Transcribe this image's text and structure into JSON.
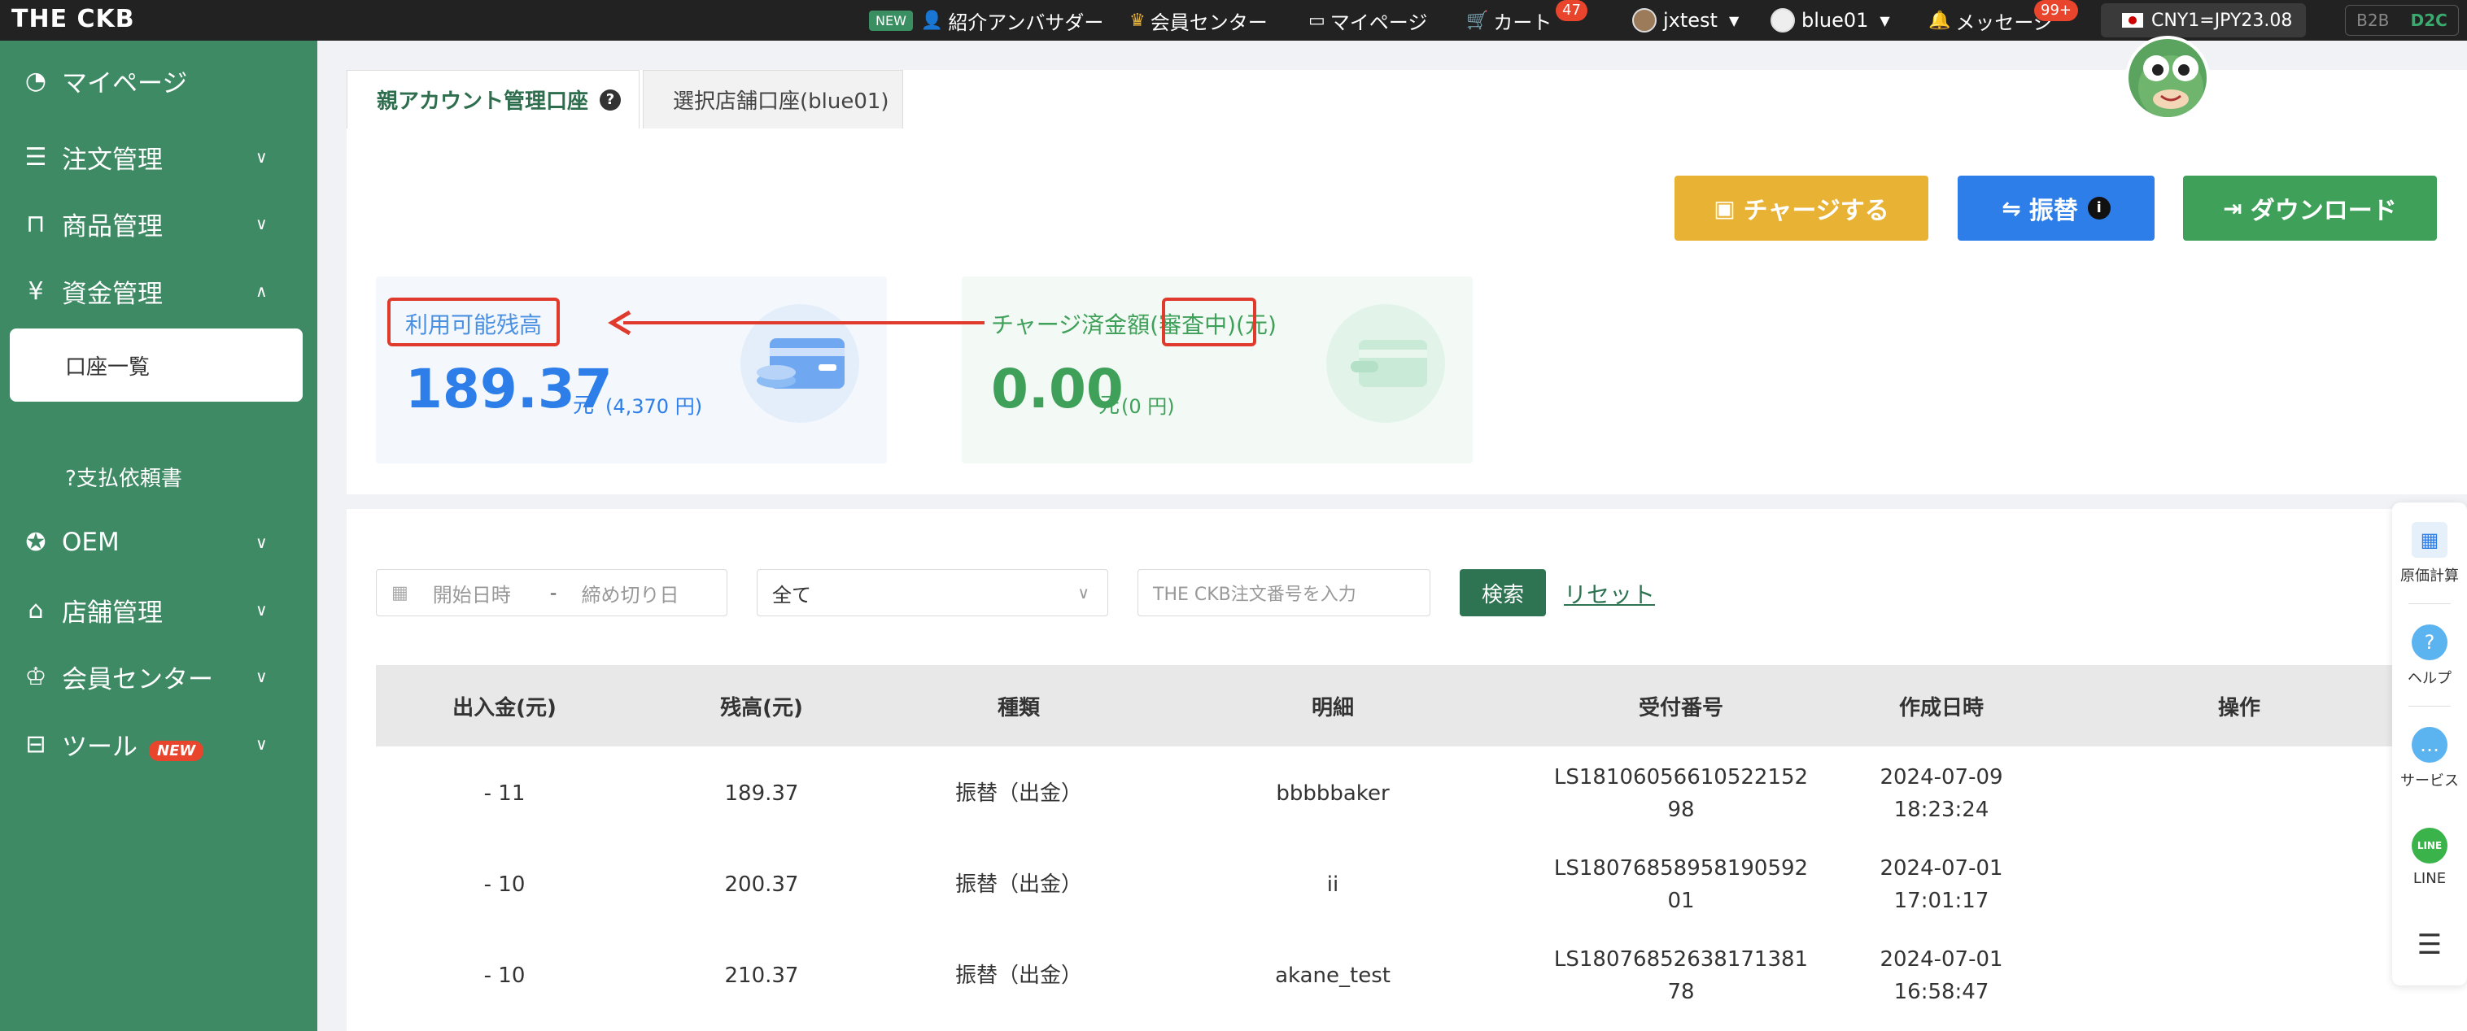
{
  "topbar": {
    "logo": "THE CKB",
    "new_tag": "NEW",
    "ambassador": "紹介アンバサダー",
    "member_center": "会員センター",
    "mypage": "マイページ",
    "cart": "カート",
    "cart_count": "47",
    "user1": "jxtest",
    "user2": "blue01",
    "messages": "メッセージ",
    "messages_count": "99+",
    "rate": "CNY1=JPY23.08",
    "b2b": "B2B",
    "d2c": "D2C"
  },
  "sidebar": {
    "mypage": "マイページ",
    "orders": "注文管理",
    "products": "商品管理",
    "funds": "資金管理",
    "account_list": "口座一覧",
    "payment_request": "支払依頼書",
    "oem": "OEM",
    "stores": "店舗管理",
    "member": "会員センター",
    "tools": "ツール",
    "tools_new": "NEW"
  },
  "tabs": {
    "parent": "親アカウント管理口座",
    "store": "選択店舗口座(blue01)"
  },
  "actions": {
    "charge": "チャージする",
    "transfer": "振替",
    "download": "ダウンロード"
  },
  "balance": {
    "available_label": "利用可能残高",
    "available_amount": "189.37",
    "available_unit": "元",
    "available_jpy": "(4,370 円)",
    "charged_label_a": "チャージ済金額",
    "charged_label_b": "(審査中",
    "charged_label_c": ")(元)",
    "charged_amount": "0.00",
    "charged_unit": "元",
    "charged_jpy": "(0 円)"
  },
  "filters": {
    "start_placeholder": "開始日時",
    "dash": "-",
    "end_placeholder": "締め切り日",
    "type_value": "全て",
    "order_placeholder": "THE CKB注文番号を入力",
    "search": "検索",
    "reset": "リセット"
  },
  "table": {
    "headers": [
      "出入金(元)",
      "残高(元)",
      "種類",
      "明細",
      "受付番号",
      "作成日時",
      "操作"
    ],
    "rows": [
      {
        "amount": "- 11",
        "balance": "189.37",
        "type": "振替（出金）",
        "detail": "bbbbbaker",
        "no_a": "LS18106056610522152",
        "no_b": "98",
        "date": "2024-07-09 18:23:24"
      },
      {
        "amount": "- 10",
        "balance": "200.37",
        "type": "振替（出金）",
        "detail": "ii",
        "no_a": "LS18076858958190592",
        "no_b": "01",
        "date": "2024-07-01 17:01:17"
      },
      {
        "amount": "- 10",
        "balance": "210.37",
        "type": "振替（出金）",
        "detail": "akane_test",
        "no_a": "LS18076852638171381",
        "no_b": "78",
        "date": "2024-07-01 16:58:47"
      }
    ]
  },
  "floatbar": {
    "cost": "原価計算",
    "help": "ヘルプ",
    "service": "サービス",
    "line": "LINE",
    "line_icon": "LINE"
  },
  "colors": {
    "sidebar": "#3d8a64",
    "blue": "#2d7ee8",
    "green": "#3fa059",
    "yellow": "#e8b334",
    "highlight_red": "#e03a2c"
  }
}
